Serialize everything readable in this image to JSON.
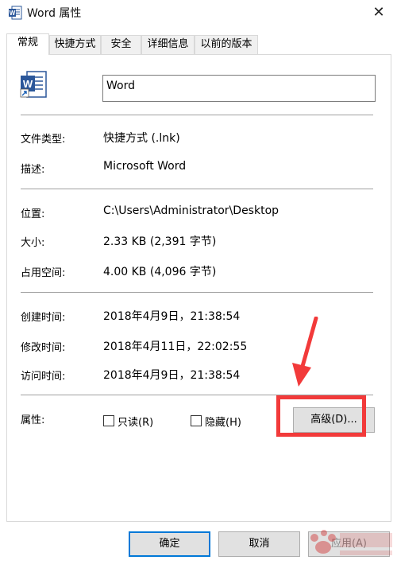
{
  "window": {
    "title": "Word 属性",
    "close_glyph": "✕"
  },
  "tabs": [
    {
      "label": "常规",
      "active": true
    },
    {
      "label": "快捷方式",
      "active": false
    },
    {
      "label": "安全",
      "active": false
    },
    {
      "label": "详细信息",
      "active": false
    },
    {
      "label": "以前的版本",
      "active": false
    }
  ],
  "general": {
    "file_name": "Word",
    "file_icon": "word-shortcut-icon",
    "rows": {
      "file_type": {
        "label": "文件类型:",
        "value": "快捷方式 (.lnk)"
      },
      "description": {
        "label": "描述:",
        "value": "Microsoft Word"
      },
      "location": {
        "label": "位置:",
        "value": "C:\\Users\\Administrator\\Desktop"
      },
      "size": {
        "label": "大小:",
        "value": "2.33 KB (2,391 字节)"
      },
      "size_on_disk": {
        "label": "占用空间:",
        "value": "4.00 KB (4,096 字节)"
      },
      "created": {
        "label": "创建时间:",
        "value": "2018年4月9日，21:38:54"
      },
      "modified": {
        "label": "修改时间:",
        "value": "2018年4月11日，22:02:55"
      },
      "accessed": {
        "label": "访问时间:",
        "value": "2018年4月9日，21:38:54"
      }
    },
    "attributes": {
      "label": "属性:",
      "readonly": {
        "label": "只读(R)",
        "checked": false
      },
      "hidden": {
        "label": "隐藏(H)",
        "checked": false
      },
      "advanced_button": "高级(D)..."
    }
  },
  "footer": {
    "ok": "确定",
    "cancel": "取消",
    "apply": "应用(A)"
  },
  "colors": {
    "annotation": "#f23a3a",
    "word_blue": "#2b579a",
    "focus_blue": "#0078d7"
  }
}
